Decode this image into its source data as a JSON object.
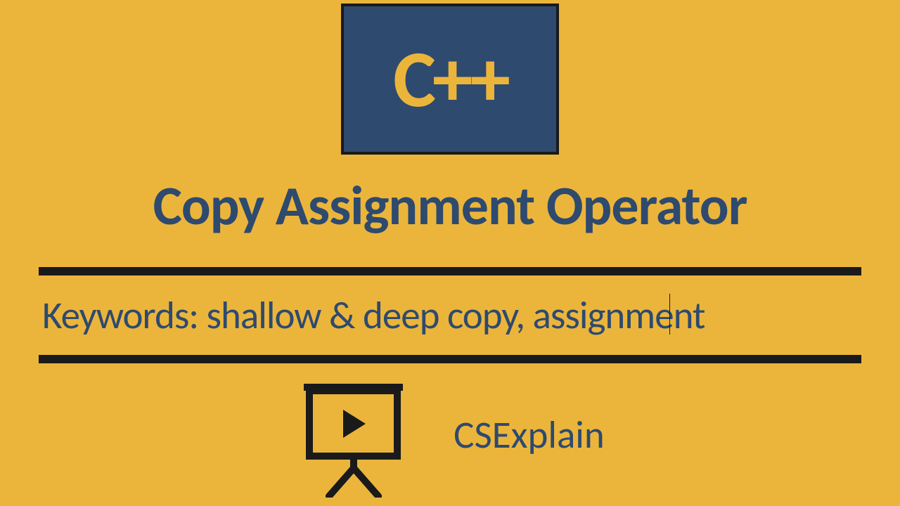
{
  "logo": {
    "text": "C++"
  },
  "title": "Copy Assignment Operator",
  "keywords": "Keywords: shallow & deep copy, assignment",
  "channel": "CSExplain"
}
